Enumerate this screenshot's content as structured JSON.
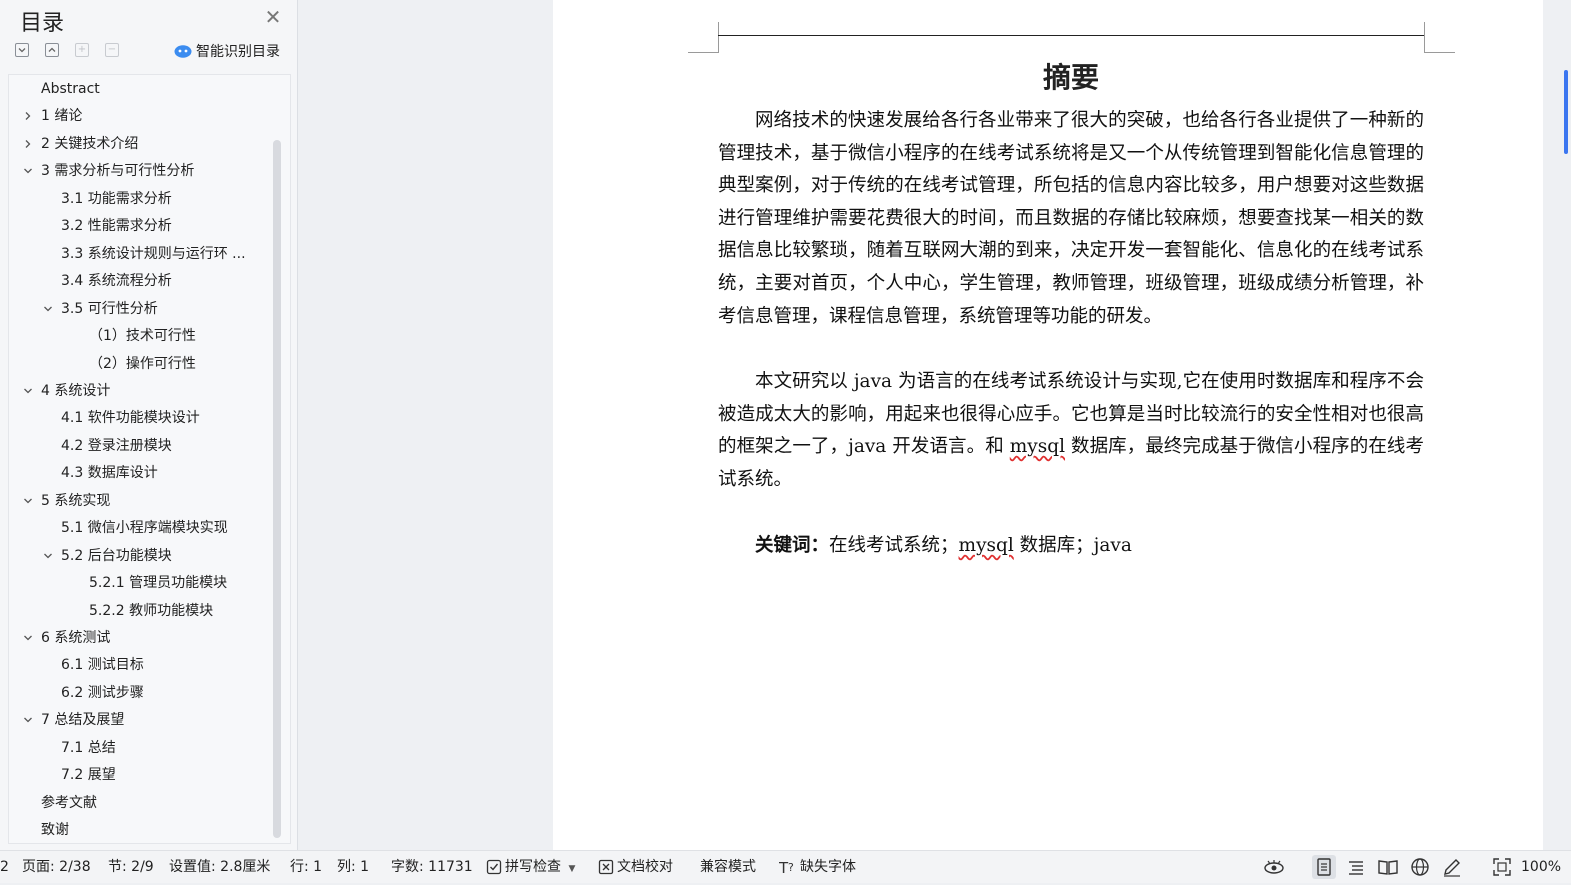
{
  "toc": {
    "title": "目录",
    "smart_toc_label": "智能识别目录",
    "items": [
      {
        "label": "Abstract",
        "level": 0,
        "arrow": "none"
      },
      {
        "label": "1 绪论",
        "level": 0,
        "arrow": "collapsed"
      },
      {
        "label": "2 关键技术介绍",
        "level": 0,
        "arrow": "collapsed"
      },
      {
        "label": "3 需求分析与可行性分析",
        "level": 0,
        "arrow": "expanded"
      },
      {
        "label": "3.1 功能需求分析",
        "level": 1,
        "arrow": "none"
      },
      {
        "label": "3.2 性能需求分析",
        "level": 1,
        "arrow": "none"
      },
      {
        "label": "3.3 系统设计规则与运行环 ...",
        "level": 1,
        "arrow": "none"
      },
      {
        "label": "3.4 系统流程分析",
        "level": 1,
        "arrow": "none"
      },
      {
        "label": "3.5 可行性分析",
        "level": 1,
        "arrow": "expanded"
      },
      {
        "label": "（1）技术可行性",
        "level": 2,
        "arrow": "none"
      },
      {
        "label": "（2）操作可行性",
        "level": 2,
        "arrow": "none"
      },
      {
        "label": "4 系统设计",
        "level": 0,
        "arrow": "expanded"
      },
      {
        "label": "4.1 软件功能模块设计",
        "level": 1,
        "arrow": "none"
      },
      {
        "label": "4.2 登录注册模块",
        "level": 1,
        "arrow": "none"
      },
      {
        "label": "4.3 数据库设计",
        "level": 1,
        "arrow": "none"
      },
      {
        "label": "5 系统实现",
        "level": 0,
        "arrow": "expanded"
      },
      {
        "label": "5.1 微信小程序端模块实现",
        "level": 1,
        "arrow": "none"
      },
      {
        "label": "5.2 后台功能模块",
        "level": 1,
        "arrow": "expanded"
      },
      {
        "label": "5.2.1 管理员功能模块",
        "level": 2,
        "arrow": "none"
      },
      {
        "label": "5.2.2 教师功能模块",
        "level": 2,
        "arrow": "none"
      },
      {
        "label": "6 系统测试",
        "level": 0,
        "arrow": "expanded"
      },
      {
        "label": "6.1 测试目标",
        "level": 1,
        "arrow": "none"
      },
      {
        "label": "6.2 测试步骤",
        "level": 1,
        "arrow": "none"
      },
      {
        "label": "7 总结及展望",
        "level": 0,
        "arrow": "expanded"
      },
      {
        "label": "7.1 总结",
        "level": 1,
        "arrow": "none"
      },
      {
        "label": "7.2 展望",
        "level": 1,
        "arrow": "none"
      },
      {
        "label": "参考文献",
        "level": 0,
        "arrow": "none"
      },
      {
        "label": "致谢",
        "level": 0,
        "arrow": "none"
      }
    ]
  },
  "document": {
    "heading": "摘要",
    "paragraph1": "网络技术的快速发展给各行各业带来了很大的突破，也给各行各业提供了一种新的管理技术，基于微信小程序的在线考试系统将是又一个从传统管理到智能化信息管理的典型案例，对于传统的在线考试管理，所包括的信息内容比较多，用户想要对这些数据进行管理维护需要花费很大的时间，而且数据的存储比较麻烦，想要查找某一相关的数据信息比较繁琐，随着互联网大潮的到来，决定开发一套智能化、信息化的在线考试系统，主要对首页，个人中心，学生管理，教师管理，班级管理，班级成绩分析管理，补考信息管理，课程信息管理，系统管理等功能的研发。",
    "paragraph2_a": "本文研究以 java 为语言的在线考试系统设计与实现,它在使用时数据库和程序不会被造成太大的影响，用起来也很得心应手。它也算是当时比较流行的安全性相对也很高的框架之一了，java 开发语言。和 ",
    "paragraph2_spell": "mysql",
    "paragraph2_b": " 数据库，最终完成基于微信小程序的在线考试系统。",
    "keywords_label": "关键词：",
    "keywords_a": "在线考试系统；",
    "keywords_spell": "mysql",
    "keywords_b": " 数据库；java"
  },
  "statusbar": {
    "page_num_fragment": "2",
    "page": "页面: 2/38",
    "section": "节: 2/9",
    "setting": "设置值: 2.8厘米",
    "row": "行: 1",
    "col": "列: 1",
    "word_count": "字数: 11731",
    "spell_check": "拼写检查",
    "doc_proof": "文档校对",
    "compat_mode": "兼容模式",
    "missing_font": "缺失字体",
    "zoom": "100%"
  },
  "colors": {
    "accent": "#3b76f0",
    "spell_error": "#e03030"
  }
}
